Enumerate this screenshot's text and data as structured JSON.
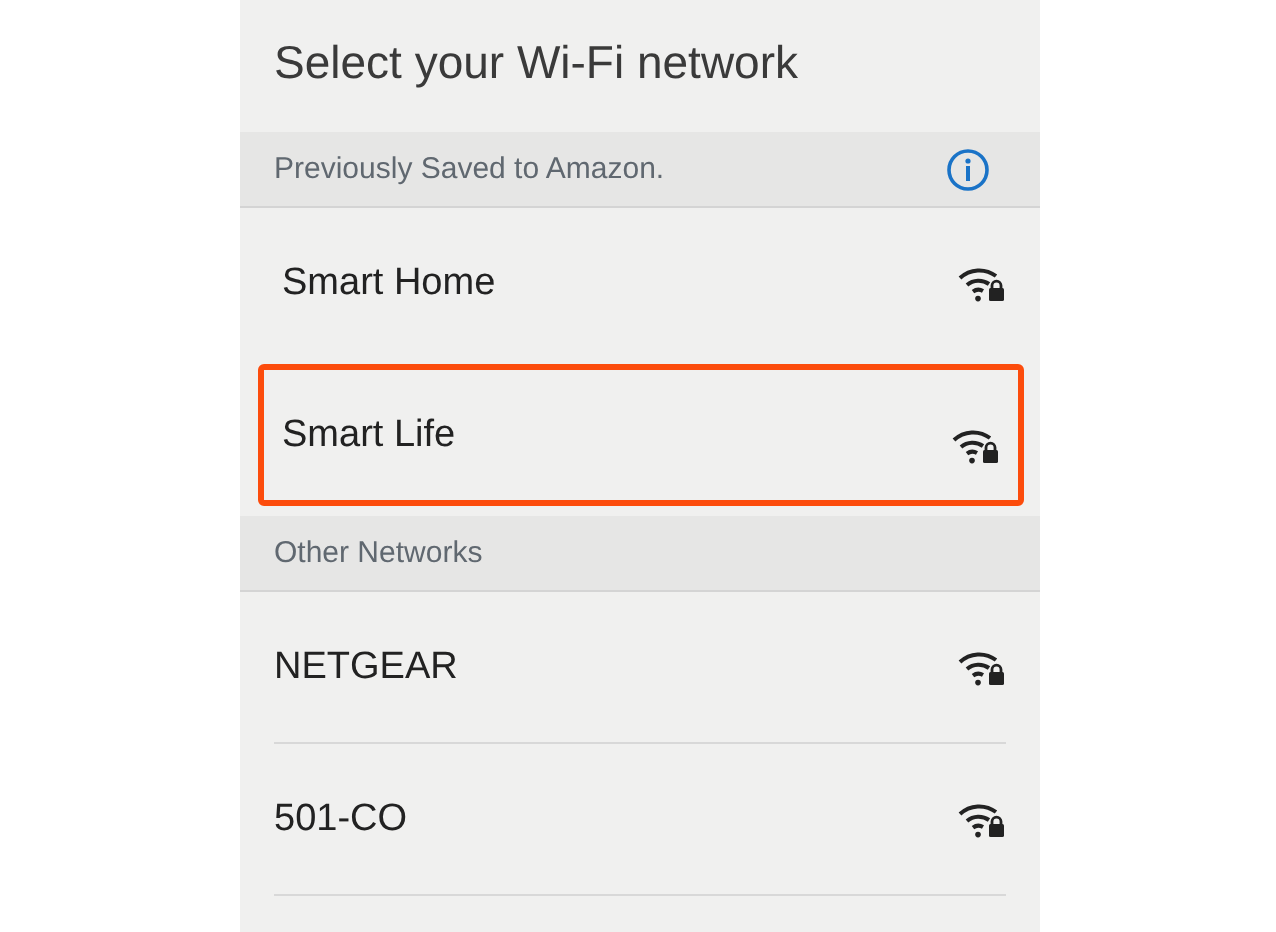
{
  "title": "Select your Wi-Fi network",
  "sections": [
    {
      "title": "Previously Saved to Amazon.",
      "info": true,
      "divided": false,
      "networks": [
        {
          "name": "Smart Home",
          "secured": true,
          "highlighted": false
        },
        {
          "name": "Smart Life",
          "secured": true,
          "highlighted": true
        }
      ]
    },
    {
      "title": "Other Networks",
      "info": false,
      "divided": true,
      "networks": [
        {
          "name": "NETGEAR",
          "secured": true,
          "highlighted": false
        },
        {
          "name": "501-CO",
          "secured": true,
          "highlighted": false
        }
      ]
    }
  ]
}
